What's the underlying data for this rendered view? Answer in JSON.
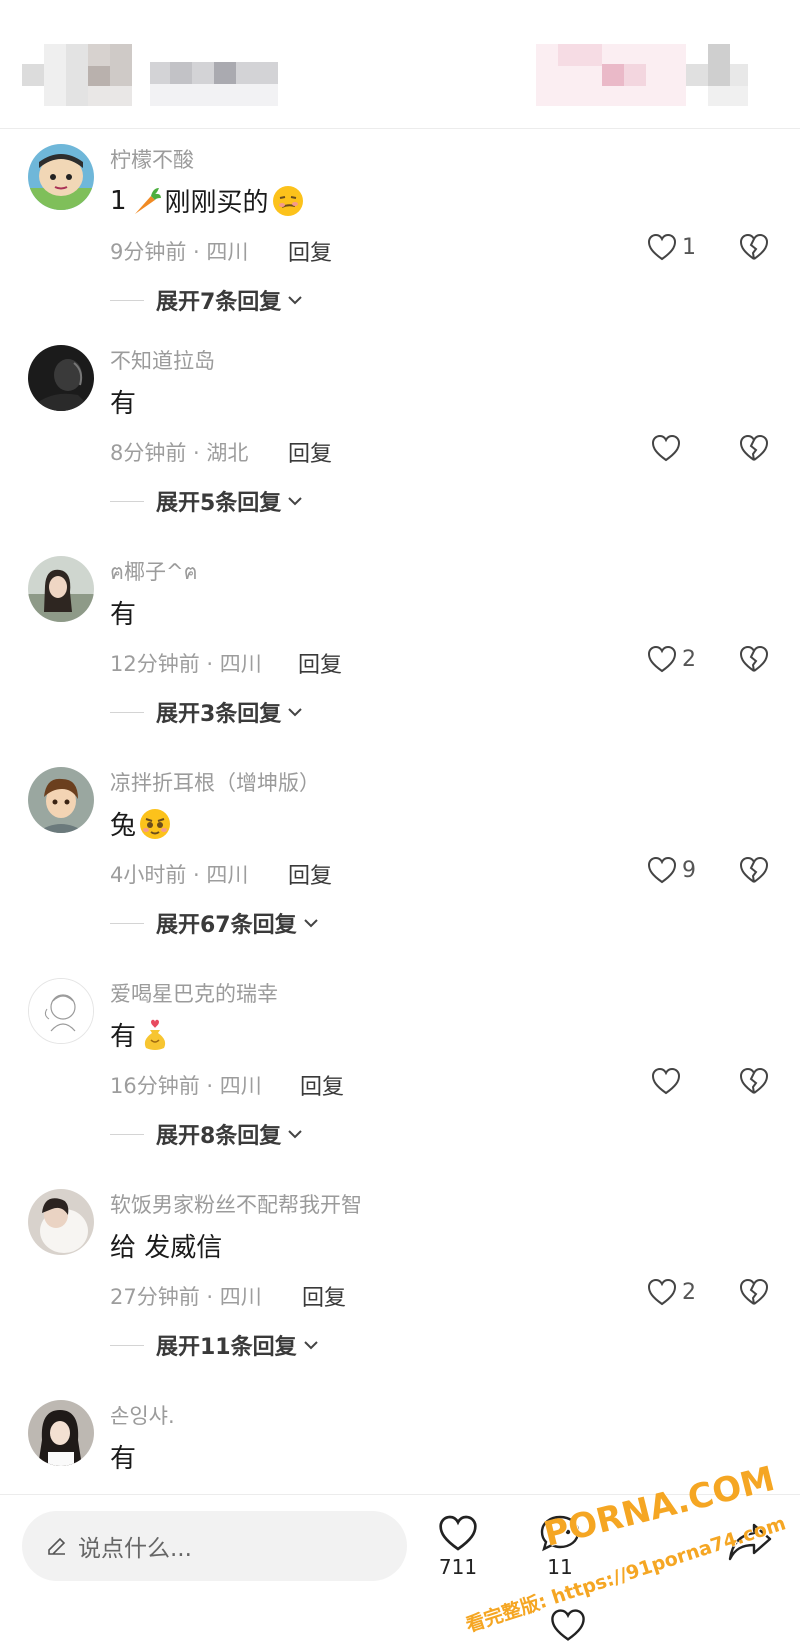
{
  "header": {
    "blurred": true
  },
  "comments": [
    {
      "name": "柠檬不酸",
      "text": "1",
      "emojis": [
        "carrot",
        "smirk-face"
      ],
      "text_after": "刚刚买的",
      "time": "9分钟前 · 四川",
      "reply_label": "回复",
      "likes": "1",
      "expand": "展开7条回复"
    },
    {
      "name": "不知道拉岛",
      "text": "有",
      "time": "8分钟前 · 湖北",
      "reply_label": "回复",
      "likes": "",
      "expand": "展开5条回复"
    },
    {
      "name": "ฅ椰子^ฅ",
      "text": "有",
      "time": "12分钟前 · 四川",
      "reply_label": "回复",
      "likes": "2",
      "expand": "展开3条回复"
    },
    {
      "name": "凉拌折耳根（增坤版）",
      "text": "兔",
      "time": "4小时前 · 四川",
      "reply_label": "回复",
      "likes": "9",
      "expand": "展开67条回复"
    },
    {
      "name": "爱喝星巴克的瑞幸",
      "text": "有",
      "time": "16分钟前 · 四川",
      "reply_label": "回复",
      "likes": "",
      "expand": "展开8条回复"
    },
    {
      "name": "软饭男家粉丝不配帮我开智",
      "text": "给 发威信",
      "time": "27分钟前 · 四川",
      "reply_label": "回复",
      "likes": "2",
      "expand": "展开11条回复"
    },
    {
      "name": "손잉샤.",
      "text": "有"
    }
  ],
  "bottom": {
    "placeholder": "说点什么...",
    "like_count": "711",
    "comment_count": "11"
  },
  "watermark": {
    "line1": "PORNA.COM",
    "line2": "看完整版: https://91porna74.com"
  },
  "colors": {
    "accent_watermark": "#f5a623",
    "meta_gray": "#9d9d9d"
  }
}
